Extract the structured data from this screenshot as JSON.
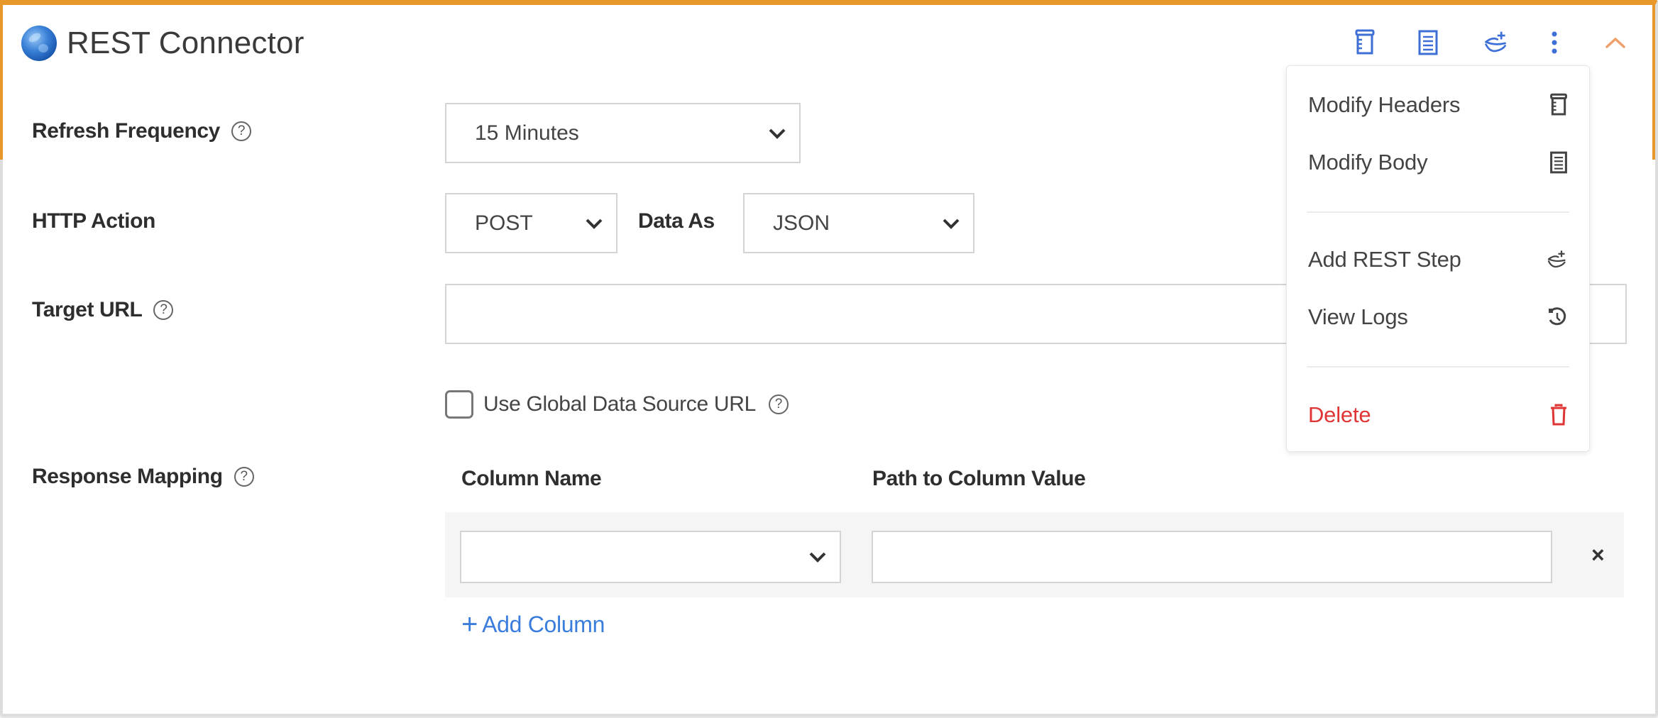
{
  "header": {
    "title": "REST Connector",
    "icons": {
      "logo": "globe-icon",
      "modify_headers": "headers-icon",
      "modify_body": "body-icon",
      "add_step": "add-step-icon",
      "more": "kebab-menu-icon",
      "collapse": "chevron-up-icon"
    }
  },
  "colors": {
    "accent_orange": "#e8972a",
    "icon_blue": "#3d6fd6",
    "link_blue": "#3b7ddd",
    "danger_red": "#e03535"
  },
  "form": {
    "refresh_frequency": {
      "label": "Refresh Frequency",
      "help": "?",
      "value": "15 Minutes"
    },
    "http_action": {
      "label": "HTTP Action",
      "value": "POST",
      "data_as_label": "Data As",
      "data_as_value": "JSON"
    },
    "target_url": {
      "label": "Target URL",
      "help": "?",
      "value": "",
      "placeholder": ""
    },
    "global_url": {
      "label": "Use Global Data Source URL",
      "help": "?",
      "checked": false
    },
    "response_mapping": {
      "label": "Response Mapping",
      "help": "?",
      "columns": [
        "Column Name",
        "Path to Column Value"
      ],
      "rows": [
        {
          "column_name": "",
          "path": "",
          "remove": "×"
        }
      ],
      "add_column": "Add Column",
      "add_icon": "+"
    }
  },
  "menu": {
    "items": [
      {
        "label": "Modify Headers",
        "icon": "headers-icon"
      },
      {
        "label": "Modify Body",
        "icon": "body-icon"
      },
      {
        "label": "Add REST Step",
        "icon": "add-step-icon"
      },
      {
        "label": "View Logs",
        "icon": "history-icon"
      },
      {
        "label": "Delete",
        "icon": "trash-icon",
        "danger": true
      }
    ]
  }
}
